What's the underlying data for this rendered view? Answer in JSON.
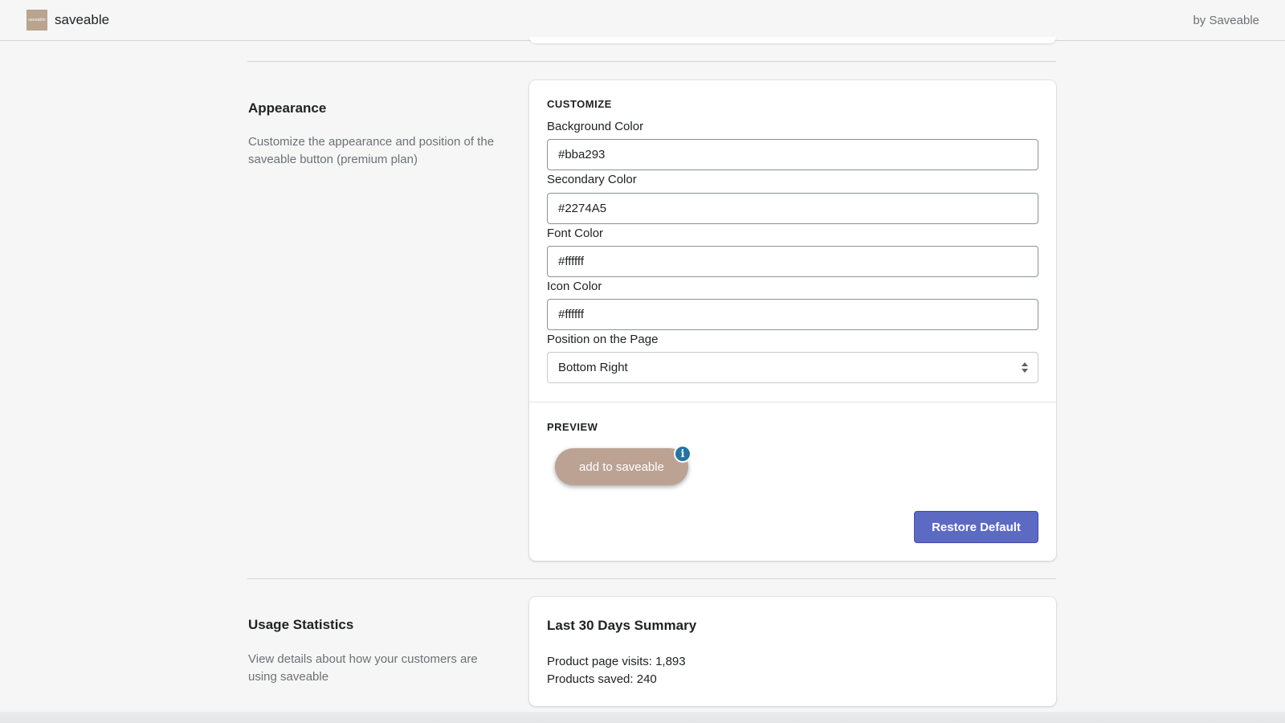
{
  "header": {
    "logo_text": "saveable",
    "app_name": "saveable",
    "by_label": "by Saveable"
  },
  "appearance": {
    "heading": "Appearance",
    "description": "Customize the appearance and position of the saveable button (premium plan)",
    "customize_title": "CUSTOMIZE",
    "fields": {
      "background_color": {
        "label": "Background Color",
        "value": "#bba293"
      },
      "secondary_color": {
        "label": "Secondary Color",
        "value": "#2274A5"
      },
      "font_color": {
        "label": "Font Color",
        "value": "#ffffff"
      },
      "icon_color": {
        "label": "Icon Color",
        "value": "#ffffff"
      }
    },
    "position": {
      "label": "Position on the Page",
      "selected": "Bottom Right"
    },
    "preview_title": "PREVIEW",
    "preview_button_label": "add to saveable",
    "info_icon_glyph": "i",
    "restore_button_label": "Restore Default"
  },
  "usage": {
    "heading": "Usage Statistics",
    "description": "View details about how your customers are using saveable",
    "summary_title": "Last 30 Days Summary",
    "product_page_visits": "Product page visits: 1,893",
    "products_saved": "Products saved: 240"
  },
  "colors": {
    "accent": "#5c6ac4",
    "preview_bg": "#bba293",
    "preview_secondary": "#2274a5"
  }
}
